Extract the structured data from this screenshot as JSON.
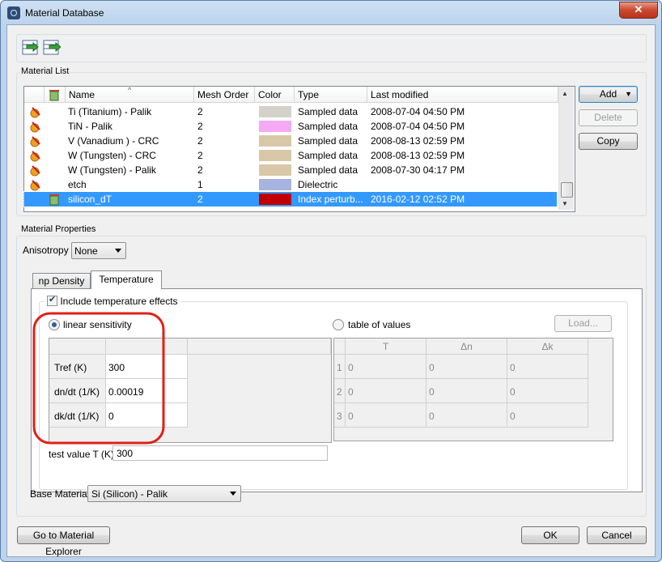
{
  "window": {
    "title": "Material Database",
    "close_label": "✕"
  },
  "material_list": {
    "group_label": "Material List",
    "columns": {
      "name": "Name",
      "mesh_order": "Mesh Order",
      "color": "Color",
      "type": "Type",
      "last_modified": "Last modified"
    },
    "rows": [
      {
        "name": "Ti (Titanium) - Palik",
        "mesh_order": "2",
        "color": "#d4d1ca",
        "type": "Sampled data",
        "last_modified": "2008-07-04 04:50 PM"
      },
      {
        "name": "TiN - Palik",
        "mesh_order": "2",
        "color": "#f5a9f5",
        "type": "Sampled data",
        "last_modified": "2008-07-04 04:50 PM"
      },
      {
        "name": "V (Vanadium ) - CRC",
        "mesh_order": "2",
        "color": "#d8c8a8",
        "type": "Sampled data",
        "last_modified": "2008-08-13 02:59 PM"
      },
      {
        "name": "W (Tungsten) - CRC",
        "mesh_order": "2",
        "color": "#d8c8a8",
        "type": "Sampled data",
        "last_modified": "2008-08-13 02:59 PM"
      },
      {
        "name": "W (Tungsten) - Palik",
        "mesh_order": "2",
        "color": "#d8c8a8",
        "type": "Sampled data",
        "last_modified": "2008-07-30 04:17 PM"
      },
      {
        "name": "etch",
        "mesh_order": "1",
        "color": "#a8b4e0",
        "type": "Dielectric",
        "last_modified": ""
      },
      {
        "name": "silicon_dT",
        "mesh_order": "2",
        "color": "#c00000",
        "type": "Index perturb...",
        "last_modified": "2016-02-12 02:52 PM"
      }
    ],
    "buttons": {
      "add": "Add",
      "delete": "Delete",
      "copy": "Copy"
    }
  },
  "material_properties": {
    "group_label": "Material Properties",
    "anisotropy_label": "Anisotropy",
    "anisotropy_value": "None",
    "tabs": [
      "np Density",
      "Temperature"
    ],
    "include_temp_label": "Include temperature effects",
    "linear_sensitivity_label": "linear sensitivity",
    "table_of_values_label": "table of values",
    "load_label": "Load...",
    "linear_rows": [
      {
        "label": "Tref (K)",
        "value": "300"
      },
      {
        "label": "dn/dt (1/K)",
        "value": "0.00019"
      },
      {
        "label": "dk/dt (1/K)",
        "value": "0"
      }
    ],
    "table_headers": [
      "T",
      "Δn",
      "Δk"
    ],
    "table_rows": [
      {
        "index": "1",
        "t": "0",
        "dn": "0",
        "dk": "0"
      },
      {
        "index": "2",
        "t": "0",
        "dn": "0",
        "dk": "0"
      },
      {
        "index": "3",
        "t": "0",
        "dn": "0",
        "dk": "0"
      }
    ],
    "test_value_label": "test value T (K)",
    "test_value": "300",
    "base_material_label": "Base Material",
    "base_material_value": "Si (Silicon) - Palik"
  },
  "footer": {
    "explorer": "Go to Material Explorer",
    "ok": "OK",
    "cancel": "Cancel"
  },
  "colors": {
    "highlight": "#3399ff",
    "annotation": "#e0201a"
  }
}
